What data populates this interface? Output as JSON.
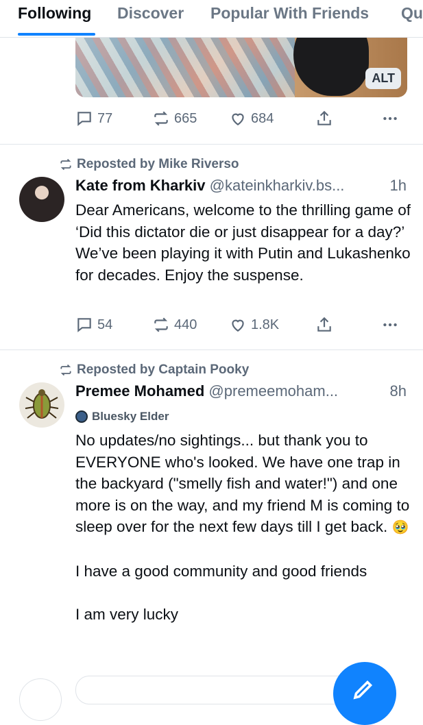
{
  "tabs": [
    {
      "label": "Following",
      "active": true
    },
    {
      "label": "Discover",
      "active": false
    },
    {
      "label": "Popular With Friends",
      "active": false
    },
    {
      "label": "Qu",
      "active": false
    }
  ],
  "top_post": {
    "alt_label": "ALT",
    "replies": "77",
    "reposts": "665",
    "likes": "684"
  },
  "post1": {
    "reposted_by": "Reposted by Mike Riverso",
    "display_name": "Kate from Kharkiv",
    "handle": "@kateinkharkiv.bs...",
    "time": "1h",
    "text": "Dear Americans, welcome to the thrilling game of ‘Did this dictator die or just disappear for a day?’ We’ve been playing it with Putin and Lukashenko for decades. Enjoy the suspense.",
    "replies": "54",
    "reposts": "440",
    "likes": "1.8K"
  },
  "post2": {
    "reposted_by": "Reposted by Captain Pooky",
    "display_name": "Premee Mohamed",
    "handle": "@premeemoham...",
    "time": "8h",
    "badge": "Bluesky Elder",
    "text_p1": "No updates/no sightings... but thank you to EVERYONE who's looked. We have one trap in the backyard (\"smelly fish and water!\") and one more is on the way, and my friend M is coming to sleep over for the next few days till I get back.",
    "emoji": "🥹",
    "text_p2": "I have a good community and good friends",
    "text_p3": "I am very lucky"
  },
  "colors": {
    "accent": "#1083fe",
    "muted": "#5b6878"
  },
  "icons": [
    "reply-icon",
    "repost-icon",
    "like-icon",
    "share-icon",
    "more-icon",
    "compose-icon"
  ]
}
